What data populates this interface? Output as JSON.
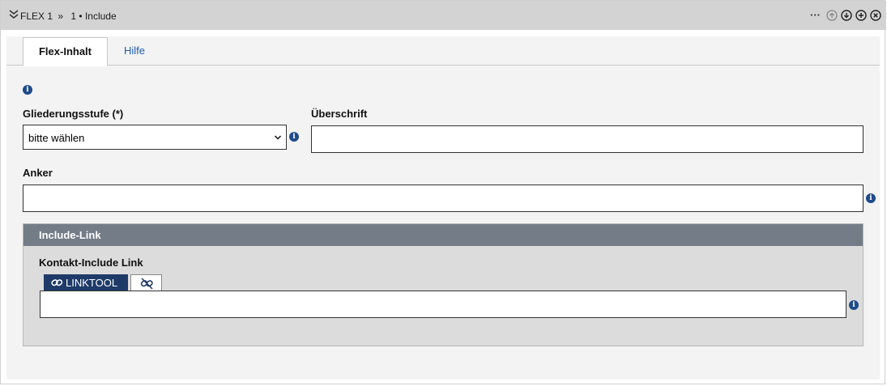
{
  "header": {
    "collapse_icon": "double-chevron-down-icon",
    "flex_label": "FLEX 1",
    "separator": "»",
    "item_label": "1 • Include",
    "actions": [
      "more-dots-icon",
      "arrow-up-circle-icon",
      "arrow-down-circle-icon",
      "plus-circle-icon",
      "close-circle-icon"
    ],
    "more_label": "···"
  },
  "tabs": [
    {
      "label": "Flex-Inhalt",
      "active": true
    },
    {
      "label": "Hilfe",
      "active": false
    }
  ],
  "form": {
    "info_icon": "info-icon",
    "gliederungsstufe": {
      "label": "Gliederungsstufe (*)",
      "value": "bitte wählen"
    },
    "ueberschrift": {
      "label": "Überschrift",
      "value": ""
    },
    "anker": {
      "label": "Anker",
      "value": ""
    }
  },
  "include_link": {
    "section_title": "Include-Link",
    "field_label": "Kontakt-Include Link",
    "linktool_label": "LINKTOOL",
    "linktool_icon": "link-icon",
    "unlink_icon": "unlink-icon",
    "value": ""
  },
  "colors": {
    "header_bg": "#d3d3d3",
    "section_bar": "#737c87",
    "linktool_bg": "#1e3a68",
    "tab_link": "#1f5da8",
    "info_icon": "#1f4a8a"
  }
}
